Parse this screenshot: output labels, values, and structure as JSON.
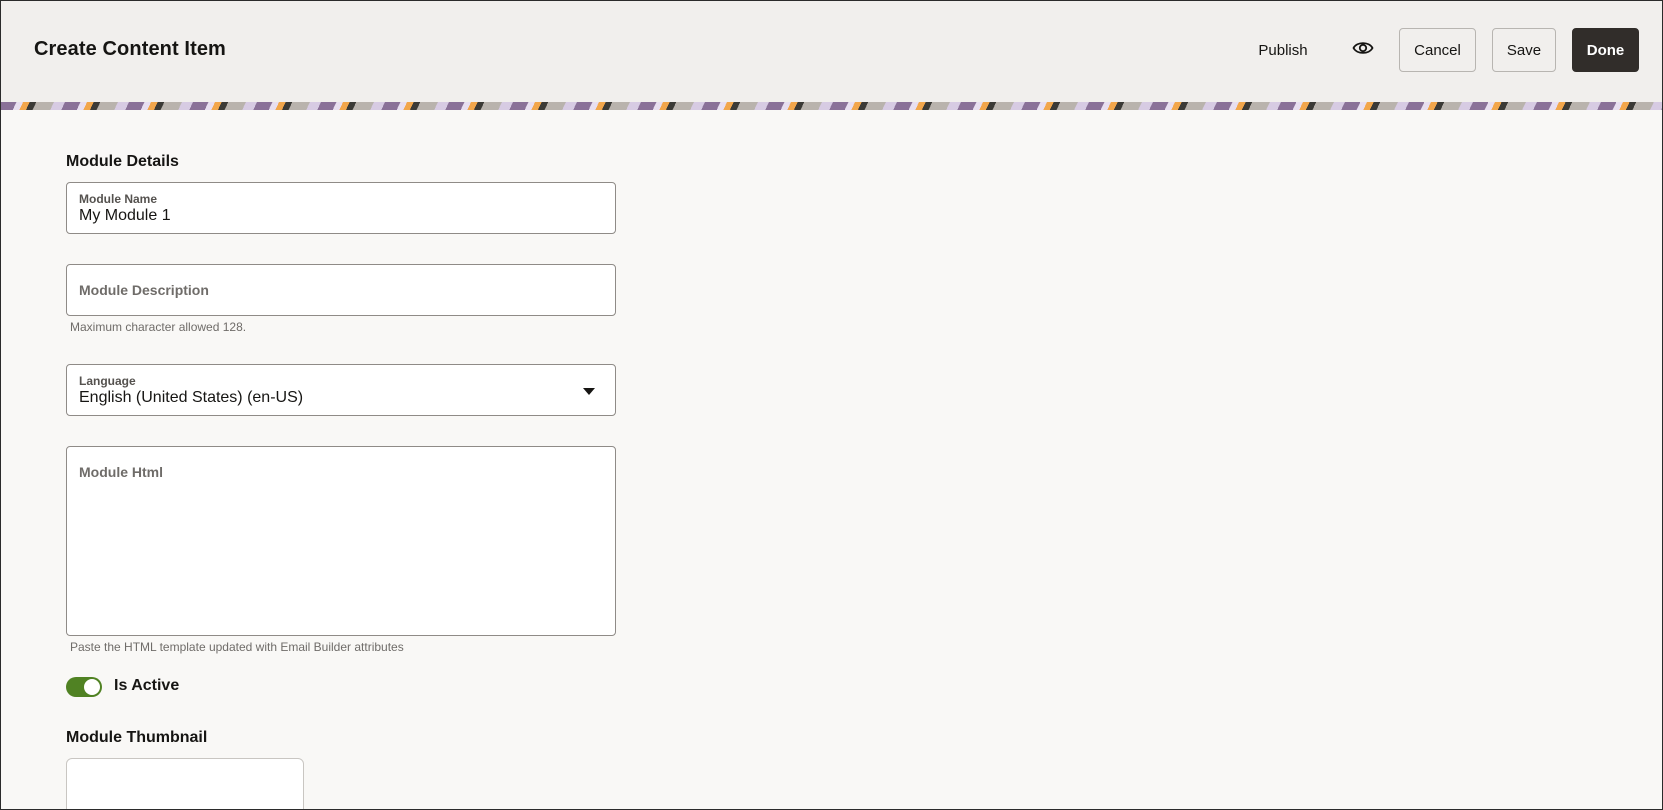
{
  "header": {
    "title": "Create Content Item",
    "publish_label": "Publish",
    "preview_icon": "eye-icon",
    "cancel_label": "Cancel",
    "save_label": "Save",
    "done_label": "Done"
  },
  "form": {
    "section_title": "Module Details",
    "module_name": {
      "label": "Module Name",
      "value": "My Module 1"
    },
    "module_description": {
      "label": "Module Description",
      "helper": "Maximum character allowed 128."
    },
    "language": {
      "label": "Language",
      "value": "English (United States) (en-US)"
    },
    "module_html": {
      "label": "Module Html",
      "helper": "Paste the HTML template updated with Email Builder attributes"
    },
    "is_active": {
      "label": "Is Active",
      "checked": true
    },
    "thumbnail_title": "Module Thumbnail"
  },
  "colors": {
    "primary_button": "#312d2a",
    "toggle_on": "#508223",
    "header_bg": "#f1efed"
  }
}
